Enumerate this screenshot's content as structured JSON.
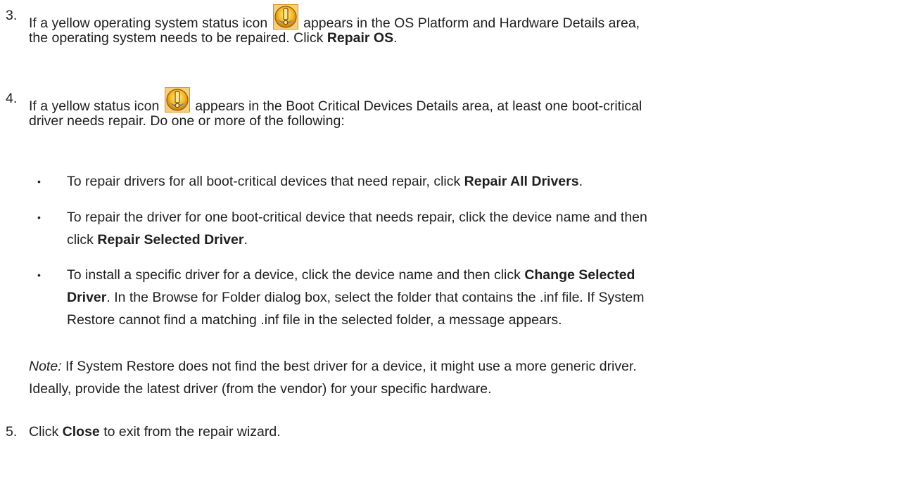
{
  "step3": {
    "number": "3.",
    "line1_before_icon": "If a yellow operating system status icon",
    "line1_after_icon": "appears in the OS Platform and Hardware Details area,",
    "line2_text": "the operating system needs to be repaired. Click ",
    "line2_bold": "Repair OS",
    "line2_end": ".",
    "icon": "yellow-warning-status-icon"
  },
  "step4": {
    "number": "4.",
    "line1_before_icon": "If a yellow status icon",
    "line1_after_icon": "appears in the Boot Critical Devices Details area, at least one boot-critical",
    "line2_text": "driver needs repair. Do one or more of the following:",
    "icon": "yellow-warning-status-icon",
    "bullets": [
      {
        "symbol": "•",
        "line1_text": "To repair drivers for all boot-critical devices that need repair, click ",
        "line1_bold": "Repair All Drivers",
        "line1_end": "."
      },
      {
        "symbol": "•",
        "line1_text": "To repair the driver for one boot-critical device that needs repair, click the device name and then",
        "line2_text": "click ",
        "line2_bold": "Repair Selected Driver",
        "line2_end": "."
      },
      {
        "symbol": "•",
        "line1_text": "To install a specific driver for a device, click the device name and then click ",
        "line1_bold": "Change Selected",
        "line2_bold": "Driver",
        "line2_text": ". In the Browse for Folder dialog box, select the folder that contains the .inf file. If System",
        "line3_text": "Restore cannot find a matching .inf file in the selected folder, a message appears."
      }
    ],
    "note": {
      "label": "Note:",
      "line1_text": " If System Restore does not find the best driver for a device, it might use a more generic driver.",
      "line2_text": "Ideally, provide the latest driver (from the vendor) for your specific hardware."
    }
  },
  "step5": {
    "number": "5.",
    "text_before": "Click ",
    "bold": "Close",
    "text_after": " to exit from the repair wizard."
  }
}
